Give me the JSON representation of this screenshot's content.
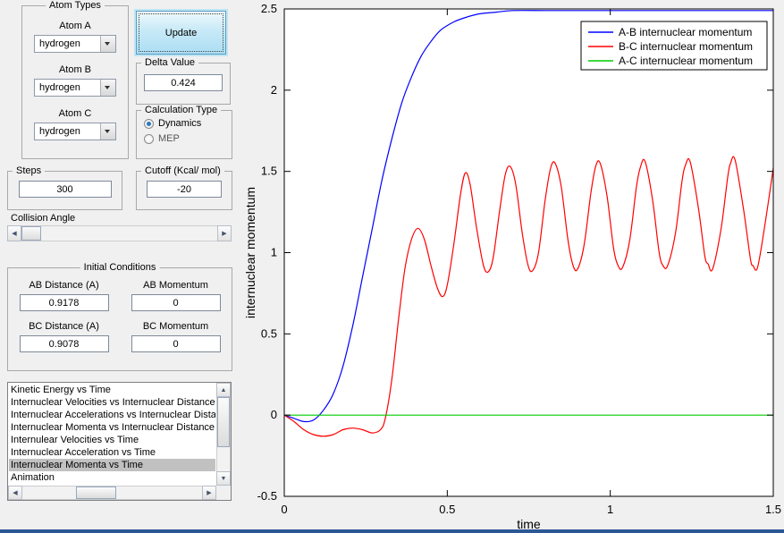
{
  "panels": {
    "atom_types": {
      "title": "Atom Types",
      "fields": [
        {
          "label": "Atom A",
          "value": "hydrogen"
        },
        {
          "label": "Atom B",
          "value": "hydrogen"
        },
        {
          "label": "Atom C",
          "value": "hydrogen"
        }
      ]
    },
    "update_button": "Update",
    "delta": {
      "title": "Delta Value",
      "value": "0.424"
    },
    "calc_type": {
      "title": "Calculation Type",
      "options": [
        {
          "label": "Dynamics",
          "selected": true
        },
        {
          "label": "MEP",
          "selected": false
        }
      ]
    },
    "steps": {
      "title": "Steps",
      "value": "300"
    },
    "cutoff": {
      "title": "Cutoff (Kcal/ mol)",
      "value": "-20"
    },
    "collision_angle": {
      "label": "Collision Angle"
    },
    "initial_conditions": {
      "title": "Initial Conditions",
      "fields": [
        {
          "label": "AB Distance (A)",
          "value": "0.9178"
        },
        {
          "label": "AB Momentum",
          "value": "0"
        },
        {
          "label": "BC Distance (A)",
          "value": "0.9078"
        },
        {
          "label": "BC Momentum",
          "value": "0"
        }
      ]
    },
    "plot_list": {
      "items": [
        "Kinetic Energy vs Time",
        "Internuclear Velocities vs Internuclear Distance",
        "Internuclear Accelerations vs Internuclear Distance",
        "Internuclear Momenta vs Internuclear Distance",
        "Internulear Velocities vs Time",
        "Internuclear Acceleration vs Time",
        "Internuclear Momenta vs Time",
        "Animation"
      ],
      "selected_index": 6
    }
  },
  "chart_data": {
    "type": "line",
    "title": "",
    "xlabel": "time",
    "ylabel": "internuclear momentum",
    "xlim": [
      0,
      1.5
    ],
    "ylim": [
      -0.5,
      2.5
    ],
    "xticks": [
      0,
      0.5,
      1,
      1.5
    ],
    "xtick_labels": [
      "0",
      "0.5",
      "1",
      "1.5"
    ],
    "yticks": [
      -0.5,
      0,
      0.5,
      1,
      1.5,
      2,
      2.5
    ],
    "ytick_labels": [
      "-0.5",
      "0",
      "0.5",
      "1",
      "1.5",
      "2",
      "2.5"
    ],
    "legend_position": "top-right",
    "grid": false,
    "series": [
      {
        "name": "A-B internuclear momentum",
        "color": "#0000ff",
        "points": [
          [
            0,
            0
          ],
          [
            0.03,
            -0.02
          ],
          [
            0.06,
            -0.04
          ],
          [
            0.09,
            -0.03
          ],
          [
            0.12,
            0.03
          ],
          [
            0.15,
            0.13
          ],
          [
            0.18,
            0.3
          ],
          [
            0.21,
            0.55
          ],
          [
            0.24,
            0.85
          ],
          [
            0.27,
            1.15
          ],
          [
            0.3,
            1.45
          ],
          [
            0.33,
            1.7
          ],
          [
            0.36,
            1.92
          ],
          [
            0.39,
            2.08
          ],
          [
            0.42,
            2.21
          ],
          [
            0.45,
            2.3
          ],
          [
            0.48,
            2.37
          ],
          [
            0.52,
            2.42
          ],
          [
            0.56,
            2.45
          ],
          [
            0.6,
            2.47
          ],
          [
            0.65,
            2.48
          ],
          [
            0.7,
            2.49
          ],
          [
            0.8,
            2.49
          ],
          [
            0.9,
            2.49
          ],
          [
            1.0,
            2.49
          ],
          [
            1.2,
            2.49
          ],
          [
            1.5,
            2.49
          ]
        ]
      },
      {
        "name": "B-C internuclear momentum",
        "color": "#ff0000",
        "points": [
          [
            0,
            0
          ],
          [
            0.03,
            -0.04
          ],
          [
            0.06,
            -0.09
          ],
          [
            0.09,
            -0.12
          ],
          [
            0.12,
            -0.13
          ],
          [
            0.15,
            -0.12
          ],
          [
            0.18,
            -0.09
          ],
          [
            0.21,
            -0.08
          ],
          [
            0.24,
            -0.09
          ],
          [
            0.27,
            -0.11
          ],
          [
            0.295,
            -0.09
          ],
          [
            0.31,
            -0.02
          ],
          [
            0.33,
            0.22
          ],
          [
            0.35,
            0.58
          ],
          [
            0.37,
            0.9
          ],
          [
            0.39,
            1.08
          ],
          [
            0.41,
            1.15
          ],
          [
            0.43,
            1.08
          ],
          [
            0.45,
            0.92
          ],
          [
            0.47,
            0.78
          ],
          [
            0.486,
            0.73
          ],
          [
            0.5,
            0.8
          ],
          [
            0.52,
            1.05
          ],
          [
            0.54,
            1.35
          ],
          [
            0.555,
            1.49
          ],
          [
            0.57,
            1.42
          ],
          [
            0.59,
            1.15
          ],
          [
            0.61,
            0.93
          ],
          [
            0.624,
            0.88
          ],
          [
            0.64,
            0.96
          ],
          [
            0.66,
            1.25
          ],
          [
            0.678,
            1.48
          ],
          [
            0.693,
            1.53
          ],
          [
            0.71,
            1.42
          ],
          [
            0.73,
            1.12
          ],
          [
            0.748,
            0.92
          ],
          [
            0.762,
            0.89
          ],
          [
            0.78,
            1.0
          ],
          [
            0.8,
            1.32
          ],
          [
            0.817,
            1.52
          ],
          [
            0.831,
            1.55
          ],
          [
            0.85,
            1.4
          ],
          [
            0.87,
            1.08
          ],
          [
            0.886,
            0.92
          ],
          [
            0.9,
            0.9
          ],
          [
            0.92,
            1.05
          ],
          [
            0.94,
            1.36
          ],
          [
            0.955,
            1.53
          ],
          [
            0.969,
            1.55
          ],
          [
            0.99,
            1.35
          ],
          [
            1.01,
            1.03
          ],
          [
            1.024,
            0.92
          ],
          [
            1.038,
            0.91
          ],
          [
            1.06,
            1.08
          ],
          [
            1.08,
            1.4
          ],
          [
            1.093,
            1.53
          ],
          [
            1.107,
            1.56
          ],
          [
            1.13,
            1.32
          ],
          [
            1.15,
            1.0
          ],
          [
            1.162,
            0.92
          ],
          [
            1.176,
            0.92
          ],
          [
            1.2,
            1.12
          ],
          [
            1.22,
            1.44
          ],
          [
            1.231,
            1.54
          ],
          [
            1.245,
            1.56
          ],
          [
            1.27,
            1.28
          ],
          [
            1.29,
            0.98
          ],
          [
            1.3,
            0.93
          ],
          [
            1.314,
            0.9
          ],
          [
            1.34,
            1.15
          ],
          [
            1.36,
            1.46
          ],
          [
            1.369,
            1.55
          ],
          [
            1.383,
            1.57
          ],
          [
            1.41,
            1.25
          ],
          [
            1.43,
            0.96
          ],
          [
            1.438,
            0.92
          ],
          [
            1.452,
            0.91
          ],
          [
            1.475,
            1.18
          ],
          [
            1.5,
            1.52
          ]
        ]
      },
      {
        "name": "A-C internuclear momentum",
        "color": "#00cc00",
        "points": [
          [
            0,
            0
          ],
          [
            1.5,
            0
          ]
        ]
      }
    ]
  }
}
